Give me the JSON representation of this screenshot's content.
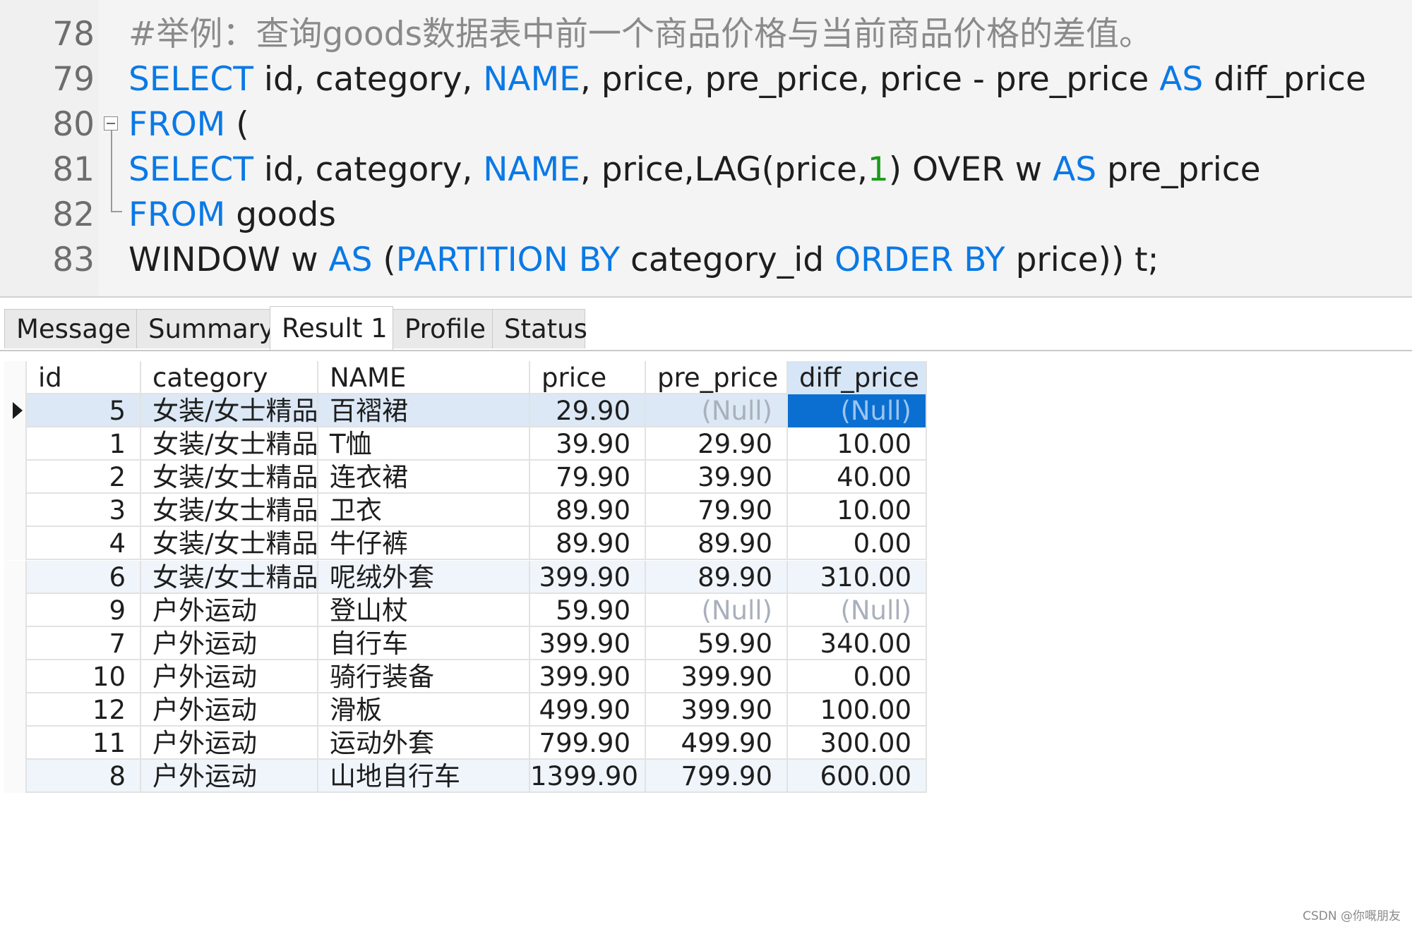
{
  "editor": {
    "lines": [
      {
        "no": "78",
        "tokens": [
          {
            "t": "#举例：查询goods数据表中前一个商品价格与当前商品价格的差值。",
            "c": "cmt"
          }
        ]
      },
      {
        "no": "79",
        "tokens": [
          {
            "t": "SELECT",
            "c": "kw"
          },
          {
            "t": " id, category, "
          },
          {
            "t": "NAME",
            "c": "kw"
          },
          {
            "t": ", price, pre_price, price - pre_price "
          },
          {
            "t": "AS",
            "c": "kw"
          },
          {
            "t": " diff_price"
          }
        ]
      },
      {
        "no": "80",
        "tokens": [
          {
            "t": "FROM",
            "c": "kw"
          },
          {
            "t": " ("
          }
        ]
      },
      {
        "no": "81",
        "tokens": [
          {
            "t": "SELECT",
            "c": "kw"
          },
          {
            "t": " id, category, "
          },
          {
            "t": "NAME",
            "c": "kw"
          },
          {
            "t": ", price,LAG(price,"
          },
          {
            "t": "1",
            "c": "num"
          },
          {
            "t": ") OVER w "
          },
          {
            "t": "AS",
            "c": "kw"
          },
          {
            "t": " pre_price"
          }
        ]
      },
      {
        "no": "82",
        "tokens": [
          {
            "t": "FROM",
            "c": "kw"
          },
          {
            "t": " goods"
          }
        ]
      },
      {
        "no": "83",
        "tokens": [
          {
            "t": "WINDOW w "
          },
          {
            "t": "AS",
            "c": "kw"
          },
          {
            "t": " ("
          },
          {
            "t": "PARTITION BY",
            "c": "kw"
          },
          {
            "t": " category_id "
          },
          {
            "t": "ORDER BY",
            "c": "kw"
          },
          {
            "t": " price)) t;"
          }
        ]
      }
    ]
  },
  "tabs": [
    "Message",
    "Summary",
    "Result 1",
    "Profile",
    "Status"
  ],
  "active_tab": "Result 1",
  "grid": {
    "columns": [
      "id",
      "category",
      "NAME",
      "price",
      "pre_price",
      "diff_price"
    ],
    "rows": [
      [
        "5",
        "女装/女士精品",
        "百褶裙",
        "29.90",
        "(Null)",
        "(Null)"
      ],
      [
        "1",
        "女装/女士精品",
        "T恤",
        "39.90",
        "29.90",
        "10.00"
      ],
      [
        "2",
        "女装/女士精品",
        "连衣裙",
        "79.90",
        "39.90",
        "40.00"
      ],
      [
        "3",
        "女装/女士精品",
        "卫衣",
        "89.90",
        "79.90",
        "10.00"
      ],
      [
        "4",
        "女装/女士精品",
        "牛仔裤",
        "89.90",
        "89.90",
        "0.00"
      ],
      [
        "6",
        "女装/女士精品",
        "呢绒外套",
        "399.90",
        "89.90",
        "310.00"
      ],
      [
        "9",
        "户外运动",
        "登山杖",
        "59.90",
        "(Null)",
        "(Null)"
      ],
      [
        "7",
        "户外运动",
        "自行车",
        "399.90",
        "59.90",
        "340.00"
      ],
      [
        "10",
        "户外运动",
        "骑行装备",
        "399.90",
        "399.90",
        "0.00"
      ],
      [
        "12",
        "户外运动",
        "滑板",
        "499.90",
        "399.90",
        "100.00"
      ],
      [
        "11",
        "户外运动",
        "运动外套",
        "799.90",
        "499.90",
        "300.00"
      ],
      [
        "8",
        "户外运动",
        "山地自行车",
        "1399.90",
        "799.90",
        "600.00"
      ]
    ]
  },
  "colors": {
    "keyword": "#0a79e6",
    "number": "#1b9b1b",
    "selected_row": "#dce8f5",
    "selected_cell": "#0a6fd1",
    "alt_row": "#f0f5fb",
    "null_text": "#a9b0bb"
  },
  "watermark": "CSDN @你嘅朋友"
}
